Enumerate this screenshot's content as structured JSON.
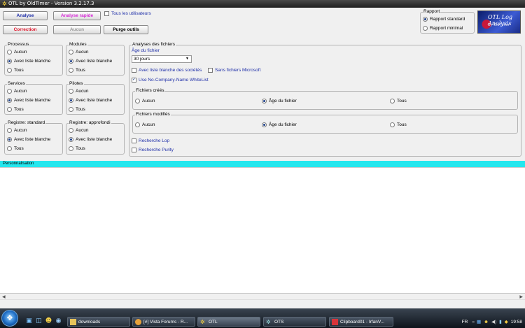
{
  "window": {
    "title": "OTL by OldTimer - Version 3.2.17.3"
  },
  "toolbar": {
    "analyse": "Analyse",
    "analyse_rapide": "Analyse rapide",
    "correction": "Correction",
    "aucun": "Aucun",
    "purge": "Purge outils",
    "tous_utilisateurs": "Tous les utilisateurs"
  },
  "rapport": {
    "title": "Rapport",
    "standard": "Rapport standard",
    "minimal": "Rapport minimal"
  },
  "logo": {
    "line1": "OTL Log Analysis",
    "line2": "By OldTimer"
  },
  "options": {
    "aucun": "Aucun",
    "blanche": "Avec liste blanche",
    "tous": "Tous"
  },
  "groups": {
    "processus": "Processus",
    "modules": "Modules",
    "services": "Services",
    "pilotes": "Pilotes",
    "registre_std": "Registre: standard",
    "registre_app": "Registre: approfondi"
  },
  "fichiers": {
    "title": "Analyses des fichiers",
    "age_label": "Âge du fichier",
    "age_value": "30 jours",
    "societes": "Avec liste blanche des sociétés",
    "sans_ms": "Sans fichiers Microsoft",
    "nocompany": "Use No-Company-Name WhiteList",
    "crees": "Fichiers créés",
    "modifies": "Fichiers modifiés",
    "aucun": "Aucun",
    "age": "Âge du fichier",
    "tous": "Tous",
    "lop": "Recherche Lop",
    "purity": "Recherche Purity"
  },
  "perso": {
    "label": "Personnalisation"
  },
  "taskbar": {
    "tasks": [
      "downloads",
      "[#] Vista Forums - R...",
      "OTL",
      "OTS",
      "Clipboard01 - IrfanV..."
    ],
    "lang": "FR",
    "time": "19:58"
  }
}
